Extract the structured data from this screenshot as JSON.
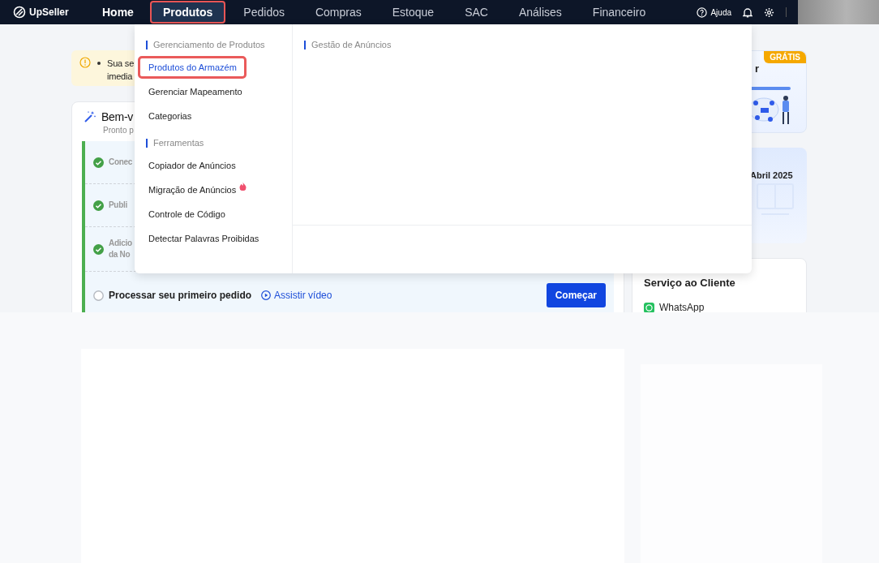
{
  "nav": {
    "logo": "UpSeller",
    "items": [
      {
        "label": "Home",
        "selected": false
      },
      {
        "label": "Produtos",
        "selected": true
      },
      {
        "label": "Pedidos",
        "selected": false
      },
      {
        "label": "Compras",
        "selected": false
      },
      {
        "label": "Estoque",
        "selected": false
      },
      {
        "label": "SAC",
        "selected": false
      },
      {
        "label": "Análises",
        "selected": false
      },
      {
        "label": "Financeiro",
        "selected": false
      }
    ],
    "help": "Ajuda"
  },
  "notice": {
    "lines": [
      "Sua se",
      "imedia"
    ]
  },
  "welcome": {
    "title": "Bem-v",
    "subtitle": "Pronto p",
    "steps": [
      {
        "lines": [
          "Conec"
        ],
        "done": true
      },
      {
        "lines": [
          "Publi"
        ],
        "done": true
      },
      {
        "lines": [
          "Adicio",
          "da No"
        ],
        "done": true
      },
      {
        "lines": [
          "Processar seu primeiro pedido"
        ],
        "done": false,
        "video": "Assistir vídeo",
        "action": "Começar"
      }
    ]
  },
  "side": {
    "promo": {
      "badge": "GRÁTIS",
      "title": "r"
    },
    "event": {
      "title": "Abril 2025"
    },
    "support": {
      "title": "Serviço ao Cliente",
      "channels": [
        "WhatsApp"
      ]
    }
  },
  "menu": {
    "groups": [
      {
        "title": "Gerenciamento de Produtos",
        "items": [
          {
            "label": "Produtos do Armazém",
            "selected": true,
            "hot": false
          },
          {
            "label": "Gerenciar Mapeamento",
            "selected": false,
            "hot": false
          },
          {
            "label": "Categorias",
            "selected": false,
            "hot": false
          }
        ]
      },
      {
        "title": "Ferramentas",
        "items": [
          {
            "label": "Copiador de Anúncios",
            "selected": false,
            "hot": false
          },
          {
            "label": "Migração de Anúncios",
            "selected": false,
            "hot": true
          },
          {
            "label": "Controle de Código",
            "selected": false,
            "hot": false
          },
          {
            "label": "Detectar Palavras Proibidas",
            "selected": false,
            "hot": false
          }
        ]
      }
    ],
    "right_title": "Gestão de Anúncios"
  }
}
